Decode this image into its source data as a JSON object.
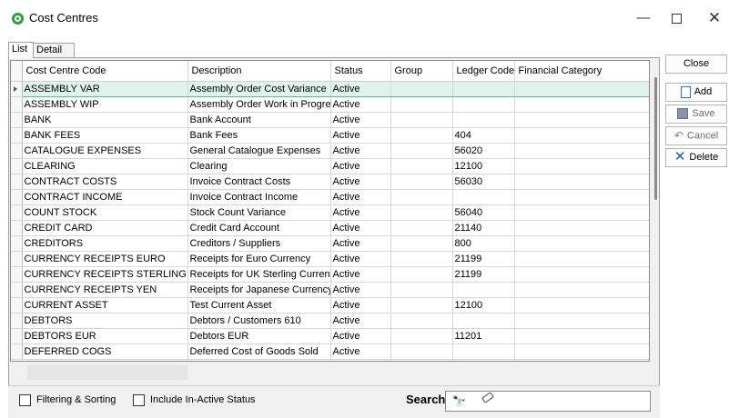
{
  "window": {
    "title": "Cost Centres",
    "minimize": "—",
    "close": "✕"
  },
  "tabs": [
    {
      "label": "List",
      "active": true
    },
    {
      "label": "Detail",
      "active": false
    }
  ],
  "grid": {
    "columns": [
      "Cost Centre Code",
      "Description",
      "Status",
      "Group",
      "Ledger Code",
      "Financial Category"
    ],
    "rows": [
      [
        "ASSEMBLY VAR",
        "Assembly Order Cost Variance",
        "Active",
        "",
        "",
        ""
      ],
      [
        "ASSEMBLY WIP",
        "Assembly Order Work in Progress",
        "Active",
        "",
        "",
        ""
      ],
      [
        "BANK",
        "Bank Account",
        "Active",
        "",
        "",
        ""
      ],
      [
        "BANK FEES",
        "Bank Fees",
        "Active",
        "",
        "404",
        ""
      ],
      [
        "CATALOGUE EXPENSES",
        "General Catalogue Expenses",
        "Active",
        "",
        "56020",
        ""
      ],
      [
        "CLEARING",
        "Clearing",
        "Active",
        "",
        "12100",
        ""
      ],
      [
        "CONTRACT COSTS",
        "Invoice Contract Costs",
        "Active",
        "",
        "56030",
        ""
      ],
      [
        "CONTRACT INCOME",
        "Invoice Contract Income",
        "Active",
        "",
        "",
        ""
      ],
      [
        "COUNT STOCK",
        "Stock Count Variance",
        "Active",
        "",
        "56040",
        ""
      ],
      [
        "CREDIT CARD",
        "Credit Card Account",
        "Active",
        "",
        "21140",
        ""
      ],
      [
        "CREDITORS",
        "Creditors / Suppliers",
        "Active",
        "",
        "800",
        ""
      ],
      [
        "CURRENCY RECEIPTS EURO",
        "Receipts for Euro Currency",
        "Active",
        "",
        "21199",
        ""
      ],
      [
        "CURRENCY RECEIPTS STERLING",
        "Receipts for UK Sterling Currency",
        "Active",
        "",
        "21199",
        ""
      ],
      [
        "CURRENCY RECEIPTS YEN",
        "Receipts for Japanese Currency",
        "Active",
        "",
        "",
        ""
      ],
      [
        "CURRENT ASSET",
        "Test Current Asset",
        "Active",
        "",
        "12100",
        ""
      ],
      [
        "DEBTORS",
        "Debtors / Customers 610",
        "Active",
        "",
        "",
        ""
      ],
      [
        "DEBTORS EUR",
        "Debtors EUR",
        "Active",
        "",
        "11201",
        ""
      ],
      [
        "DEFERRED COGS",
        "Deferred Cost of Goods Sold",
        "Active",
        "",
        "",
        ""
      ]
    ],
    "selected_row": 0
  },
  "filters": {
    "filtering_sorting_label": "Filtering & Sorting",
    "filtering_sorting_checked": false,
    "include_inactive_label": "Include In-Active Status",
    "include_inactive_checked": false,
    "search_label": "Search",
    "search_value": ""
  },
  "actions": {
    "close": "Close",
    "add": "Add",
    "save": "Save",
    "cancel": "Cancel",
    "delete": "Delete"
  },
  "icons": {
    "app": "app-logo-icon",
    "add": "new-document-icon",
    "save": "floppy-disk-icon",
    "cancel": "undo-icon",
    "delete": "delete-x-icon",
    "search": "binoculars-icon",
    "clear": "eraser-icon"
  },
  "colors": {
    "selected_row": "#dff3ec",
    "selected_border": "#59b895",
    "app_icon": "#2e9e3e",
    "delete_icon": "#1a5fb4"
  }
}
